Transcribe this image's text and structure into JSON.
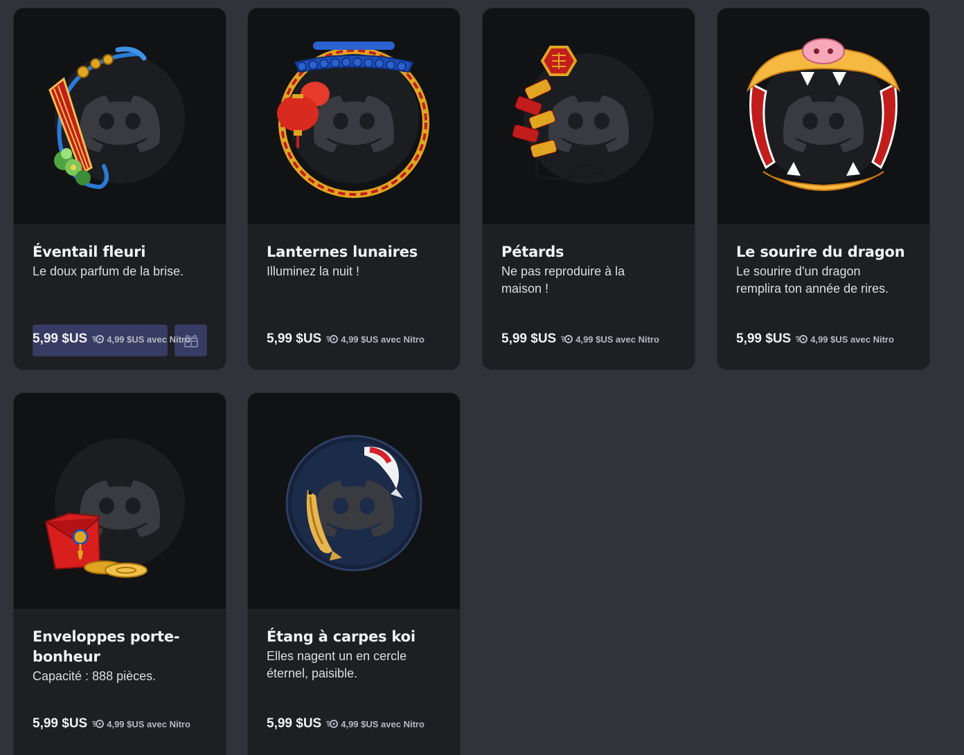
{
  "cards": [
    {
      "title": "Éventail fleuri",
      "description": "Le doux parfum de la brise.",
      "price": "5,99 $US",
      "nitro_price": "4,99 $US avec Nitro",
      "icon": "fan-decoration-icon"
    },
    {
      "title": "Lanternes lunaires",
      "description": "Illuminez la nuit !",
      "price": "5,99 $US",
      "nitro_price": "4,99 $US avec Nitro",
      "icon": "lantern-decoration-icon"
    },
    {
      "title": "Pétards",
      "description": "Ne pas reproduire à la maison !",
      "price": "5,99 $US",
      "nitro_price": "4,99 $US avec Nitro",
      "icon": "firecracker-decoration-icon"
    },
    {
      "title": "Le sourire du dragon",
      "description": "Le sourire d'un dragon remplira ton année de rires.",
      "price": "5,99 $US",
      "nitro_price": "4,99 $US avec Nitro",
      "icon": "dragon-decoration-icon"
    },
    {
      "title": "Enveloppes porte-bonheur",
      "description": "Capacité : 888 pièces.",
      "price": "5,99 $US",
      "nitro_price": "4,99 $US avec Nitro",
      "icon": "red-envelope-decoration-icon"
    },
    {
      "title": "Étang à carpes koi",
      "description": "Elles nagent un en cercle éternel, paisible.",
      "price": "5,99 $US",
      "nitro_price": "4,99 $US avec Nitro",
      "icon": "koi-pond-decoration-icon"
    }
  ],
  "hover_card": {
    "index": 0,
    "buttons": [
      "buy-button",
      "gift-icon"
    ]
  },
  "colors": {
    "background": "#313338",
    "card": "#1e1f22",
    "preview": "#111214",
    "avatar": "#1c1d20",
    "discord_logo": "#3a3b40",
    "hover_button": "#3c4270"
  }
}
